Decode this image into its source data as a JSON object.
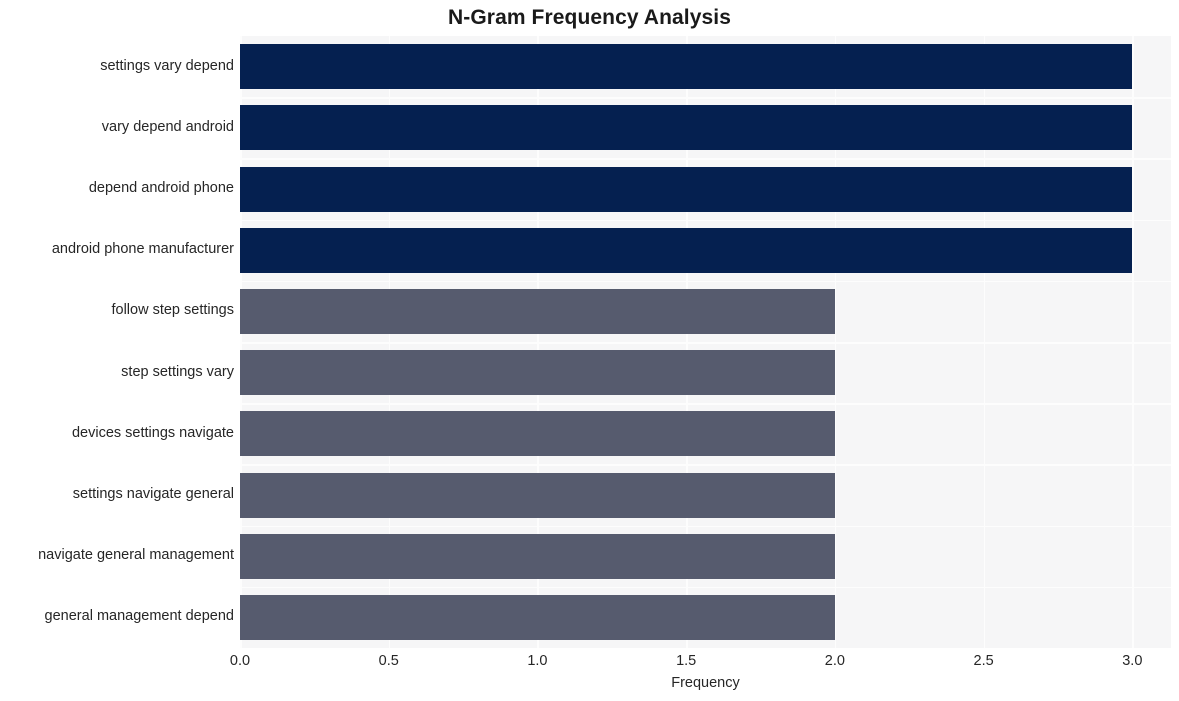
{
  "chart_data": {
    "type": "bar",
    "orientation": "horizontal",
    "title": "N-Gram Frequency Analysis",
    "xlabel": "Frequency",
    "ylabel": "",
    "categories": [
      "settings vary depend",
      "vary depend android",
      "depend android phone",
      "android phone manufacturer",
      "follow step settings",
      "step settings vary",
      "devices settings navigate",
      "settings navigate general",
      "navigate general management",
      "general management depend"
    ],
    "values": [
      3,
      3,
      3,
      3,
      2,
      2,
      2,
      2,
      2,
      2
    ],
    "bar_colors": [
      "#052050",
      "#052050",
      "#052050",
      "#052050",
      "#565b6e",
      "#565b6e",
      "#565b6e",
      "#565b6e",
      "#565b6e",
      "#565b6e"
    ],
    "xlim": [
      0,
      3.13
    ],
    "xticks": [
      0.0,
      0.5,
      1.0,
      1.5,
      2.0,
      2.5,
      3.0
    ],
    "xtick_labels": [
      "0.0",
      "0.5",
      "1.0",
      "1.5",
      "2.0",
      "2.5",
      "3.0"
    ],
    "grid": true,
    "grid_color": "#fdfdfd",
    "plot_background": "#f6f6f7",
    "figure_background": "#ffffff",
    "legend": null
  },
  "colors": {
    "accent_high": "#052050",
    "accent_low": "#565b6e",
    "text": "#262626",
    "title": "#1a1a1a"
  }
}
